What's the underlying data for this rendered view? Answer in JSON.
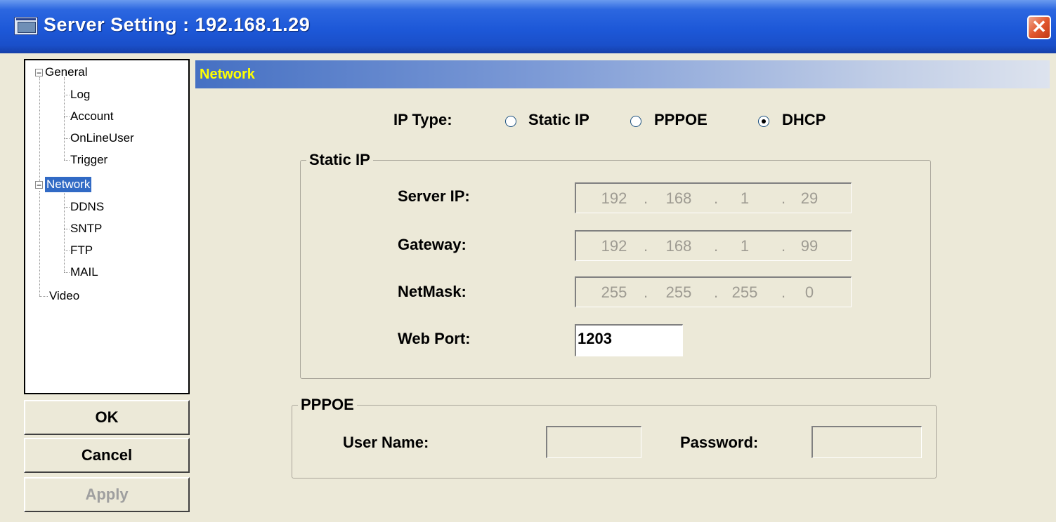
{
  "window": {
    "title": "Server Setting : 192.168.1.29",
    "close_label": "✕"
  },
  "tree": {
    "items": [
      {
        "label": "General",
        "expander": "−"
      },
      {
        "label": "Log"
      },
      {
        "label": "Account"
      },
      {
        "label": "OnLineUser"
      },
      {
        "label": "Trigger"
      },
      {
        "label": "Network",
        "expander": "−",
        "selected": true
      },
      {
        "label": "DDNS"
      },
      {
        "label": "SNTP"
      },
      {
        "label": "FTP"
      },
      {
        "label": "MAIL"
      },
      {
        "label": "Video"
      }
    ]
  },
  "buttons": {
    "ok": "OK",
    "cancel": "Cancel",
    "apply": "Apply"
  },
  "section": {
    "title": "Network"
  },
  "ip_type": {
    "label": "IP Type:",
    "options": [
      {
        "label": "Static IP",
        "checked": false
      },
      {
        "label": "PPPOE",
        "checked": false
      },
      {
        "label": "DHCP",
        "checked": true
      }
    ]
  },
  "static_ip": {
    "legend": "Static IP",
    "server_ip": {
      "label": "Server IP:",
      "octets": [
        "192",
        "168",
        "1",
        "29"
      ]
    },
    "gateway": {
      "label": "Gateway:",
      "octets": [
        "192",
        "168",
        "1",
        "99"
      ]
    },
    "netmask": {
      "label": "NetMask:",
      "octets": [
        "255",
        "255",
        "255",
        "0"
      ]
    },
    "web_port": {
      "label": "Web Port:",
      "value": "1203"
    }
  },
  "pppoe": {
    "legend": "PPPOE",
    "username_label": "User Name:",
    "username_value": "",
    "password_label": "Password:",
    "password_value": ""
  },
  "colors": {
    "header_text": "#ffff00",
    "selection": "#316ac5",
    "title_bar": "#1d58d8",
    "dialog_bg": "#ece9d8"
  }
}
